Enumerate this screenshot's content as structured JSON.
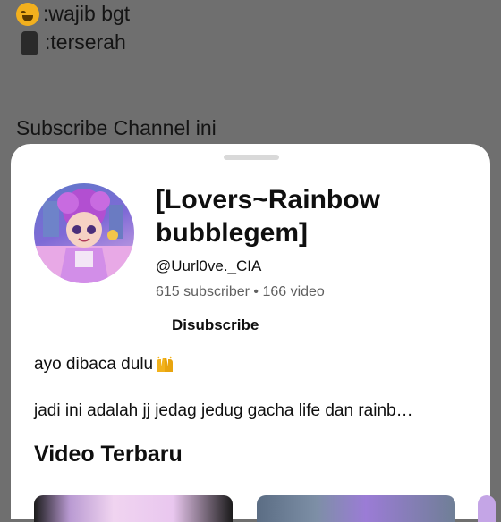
{
  "background": {
    "lines": [
      {
        "icon": "laughing-emoji-icon",
        "text": ":wajib bgt"
      },
      {
        "icon": "moai-emoji-icon",
        "text": ":terserah"
      }
    ],
    "subscribe_note": "Subscribe Channel ini"
  },
  "channel": {
    "title": "[Lovers~Rainbow bubblegem]",
    "handle": "@Uurl0ve._CIA",
    "stats": "615 subscriber • 166 video",
    "unsubscribe_label": "Disubscribe",
    "description_line1": "ayo dibaca dulu",
    "description_line1_icon": "raising-hands-emoji-icon",
    "description_line2": "jadi ini adalah jj jedag jedug gacha life dan rainb…"
  },
  "videos": {
    "section_title": "Video Terbaru"
  },
  "colors": {
    "overlay": "#6f6f6f",
    "sheet": "#ffffff",
    "text_primary": "#0f0f0f",
    "text_secondary": "#606060"
  }
}
